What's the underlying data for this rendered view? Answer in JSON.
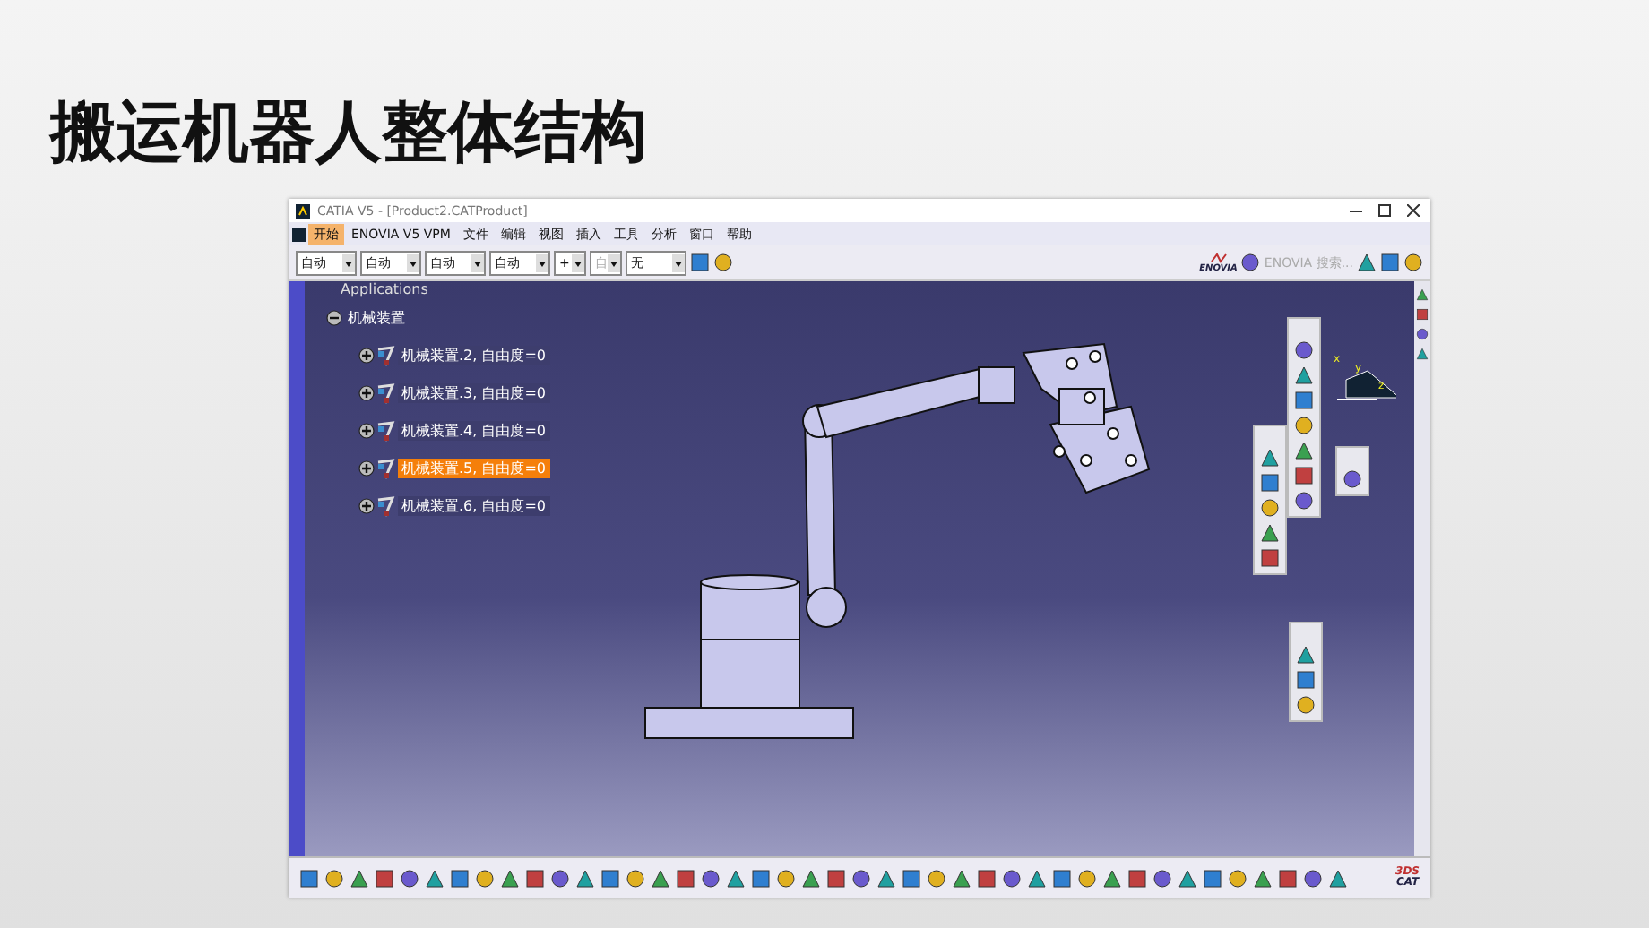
{
  "slide_title": "搬运机器人整体结构",
  "window": {
    "title": "CATIA V5 - [Product2.CATProduct]"
  },
  "menu": [
    {
      "label": "开始",
      "selected": true
    },
    {
      "label": "ENOVIA V5 VPM",
      "selected": false
    },
    {
      "label": "文件",
      "selected": false
    },
    {
      "label": "编辑",
      "selected": false
    },
    {
      "label": "视图",
      "selected": false
    },
    {
      "label": "插入",
      "selected": false
    },
    {
      "label": "工具",
      "selected": false
    },
    {
      "label": "分析",
      "selected": false
    },
    {
      "label": "窗口",
      "selected": false
    },
    {
      "label": "帮助",
      "selected": false
    }
  ],
  "toolbar_dropdowns": [
    {
      "value": "自动",
      "disabled": false
    },
    {
      "value": "自动",
      "disabled": false
    },
    {
      "value": "自动",
      "disabled": false
    },
    {
      "value": "自动",
      "disabled": false
    },
    {
      "value": "+",
      "disabled": false
    },
    {
      "value": "自",
      "disabled": true
    },
    {
      "value": "无",
      "disabled": false
    }
  ],
  "enovia": {
    "brand": "ENOVIA",
    "search_label": "ENOVIA 搜索..."
  },
  "tree": {
    "root": "Applications",
    "node": {
      "label": "机械装置",
      "expanded": true,
      "children": [
        {
          "label": "机械装置.2, 自由度=0",
          "selected": false
        },
        {
          "label": "机械装置.3, 自由度=0",
          "selected": false
        },
        {
          "label": "机械装置.4, 自由度=0",
          "selected": false
        },
        {
          "label": "机械装置.5, 自由度=0",
          "selected": true
        },
        {
          "label": "机械装置.6, 自由度=0",
          "selected": false
        }
      ]
    }
  },
  "compass": {
    "axes": [
      "x",
      "y",
      "z"
    ]
  },
  "brand_mark": {
    "top": "3DS",
    "bottom": "CAT"
  }
}
